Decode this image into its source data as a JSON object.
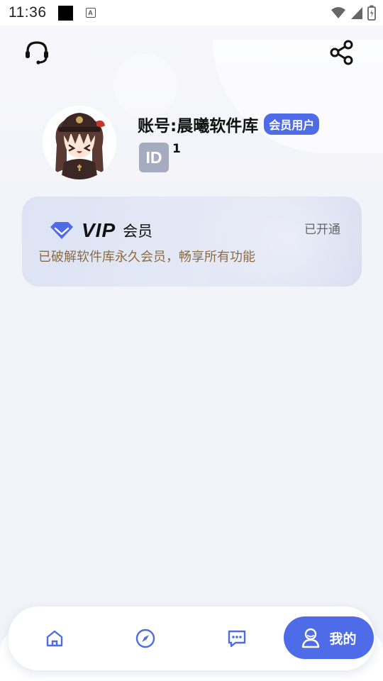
{
  "status_bar": {
    "time": "11:36",
    "notification_letter": "A",
    "icons": [
      "wifi-icon",
      "signal-icon",
      "battery-icon"
    ]
  },
  "header": {
    "icons": [
      "headset-icon",
      "share-icon"
    ]
  },
  "profile": {
    "account_name": "账号:晨曦软件库",
    "member_badge": "会员用户",
    "id_badge": "ID",
    "id_value": "1"
  },
  "vip_card": {
    "vip_label": "VIP",
    "member_label": "会员",
    "status": "已开通",
    "description": "已破解软件库永久会员，畅享所有功能"
  },
  "bottom_nav": {
    "items": [
      {
        "icon": "home-icon",
        "active": false
      },
      {
        "icon": "compass-icon",
        "active": false
      },
      {
        "icon": "chat-icon",
        "active": false
      },
      {
        "icon": "user-icon",
        "label": "我的",
        "active": true
      }
    ]
  },
  "colors": {
    "accent": "#4f6ce8",
    "vip_desc": "#8b6d45",
    "id_badge": "#a6acbf",
    "background": "#f3f4f9"
  }
}
